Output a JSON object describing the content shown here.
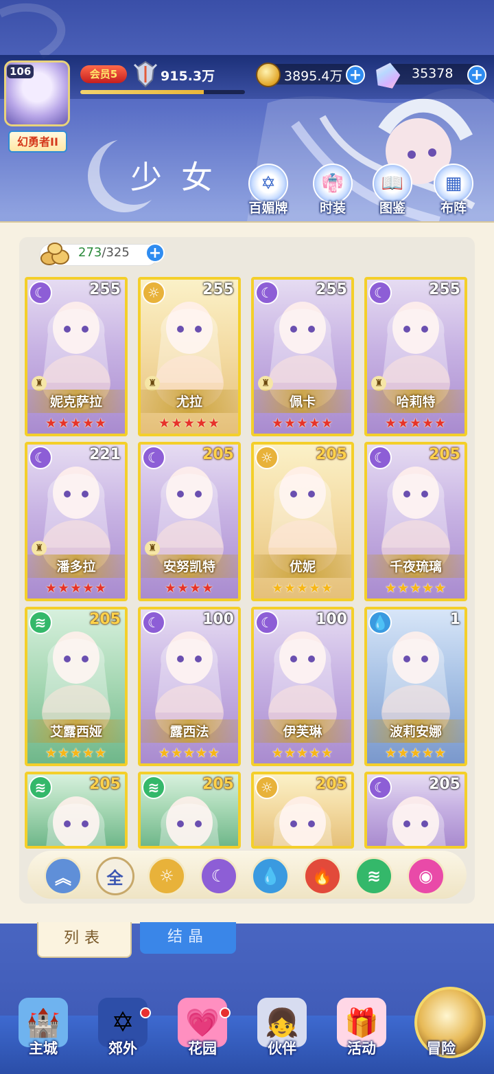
{
  "player": {
    "level": "106",
    "title": "幻勇者II",
    "vip": "会员5",
    "power": "915.3万",
    "exp_progress": 0.75
  },
  "currency": {
    "gold": "3895.4万",
    "gems": "35378"
  },
  "header": {
    "title": "少女",
    "buttons": [
      {
        "label": "百媚牌",
        "icon": "card-icon"
      },
      {
        "label": "时装",
        "icon": "outfit-icon"
      },
      {
        "label": "图鉴",
        "icon": "book-icon"
      },
      {
        "label": "布阵",
        "icon": "grid-icon"
      }
    ]
  },
  "roster": {
    "count": "273",
    "max": "325"
  },
  "cards": [
    {
      "name": "妮克萨拉",
      "level": "255",
      "element": "moon",
      "stars": 5,
      "star_color": "red",
      "rook": true,
      "level_color": "white"
    },
    {
      "name": "尤拉",
      "level": "255",
      "element": "sun",
      "stars": 5,
      "star_color": "red",
      "rook": true,
      "level_color": "white"
    },
    {
      "name": "佩卡",
      "level": "255",
      "element": "moon",
      "stars": 5,
      "star_color": "red",
      "rook": true,
      "level_color": "white"
    },
    {
      "name": "哈莉特",
      "level": "255",
      "element": "moon",
      "stars": 5,
      "star_color": "red",
      "rook": true,
      "level_color": "white"
    },
    {
      "name": "潘多拉",
      "level": "221",
      "element": "moon",
      "stars": 5,
      "star_color": "red",
      "rook": true,
      "level_color": "white"
    },
    {
      "name": "安努凯特",
      "level": "205",
      "element": "moon",
      "stars": 4,
      "star_color": "red",
      "rook": true,
      "level_color": "gold"
    },
    {
      "name": "优妮",
      "level": "205",
      "element": "sun",
      "stars": 5,
      "star_color": "gold",
      "rook": false,
      "level_color": "gold"
    },
    {
      "name": "千夜琉璃",
      "level": "205",
      "element": "moon",
      "stars": 5,
      "star_color": "gold",
      "rook": false,
      "level_color": "gold"
    },
    {
      "name": "艾露西娅",
      "level": "205",
      "element": "wind",
      "stars": 5,
      "star_color": "gold",
      "rook": false,
      "level_color": "gold"
    },
    {
      "name": "露西法",
      "level": "100",
      "element": "moon",
      "stars": 5,
      "star_color": "gold",
      "rook": false,
      "level_color": "white"
    },
    {
      "name": "伊芙琳",
      "level": "100",
      "element": "moon",
      "stars": 5,
      "star_color": "gold",
      "rook": false,
      "level_color": "white"
    },
    {
      "name": "波莉安娜",
      "level": "1",
      "element": "water",
      "stars": 5,
      "star_color": "gold",
      "rook": false,
      "level_color": "white"
    },
    {
      "name": "",
      "level": "205",
      "element": "wind",
      "stars": 0,
      "star_color": "gold",
      "rook": false,
      "level_color": "gold"
    },
    {
      "name": "",
      "level": "205",
      "element": "wind",
      "stars": 0,
      "star_color": "gold",
      "rook": false,
      "level_color": "gold"
    },
    {
      "name": "",
      "level": "205",
      "element": "sun",
      "stars": 0,
      "star_color": "gold",
      "rook": false,
      "level_color": "gold"
    },
    {
      "name": "",
      "level": "205",
      "element": "moon",
      "stars": 0,
      "star_color": "gold",
      "rook": false,
      "level_color": "white"
    }
  ],
  "filters": [
    {
      "key": "collapse",
      "label": "",
      "color": "#5f8fd8"
    },
    {
      "key": "all",
      "label": "全",
      "color": "#f5efe0"
    },
    {
      "key": "sun",
      "label": "",
      "color": "#e8b23a"
    },
    {
      "key": "moon",
      "label": "",
      "color": "#8d5ed6"
    },
    {
      "key": "water",
      "label": "",
      "color": "#3a9ae0"
    },
    {
      "key": "fire",
      "label": "",
      "color": "#e24a3a"
    },
    {
      "key": "wind",
      "label": "",
      "color": "#34b86a"
    },
    {
      "key": "spirit",
      "label": "",
      "color": "#e94aa8"
    }
  ],
  "tabs": {
    "list": "列表",
    "crystal": "结晶"
  },
  "nav": [
    {
      "label": "主城",
      "icon": "castle-icon",
      "badge": false
    },
    {
      "label": "郊外",
      "icon": "wilds-icon",
      "badge": true
    },
    {
      "label": "花园",
      "icon": "garden-icon",
      "badge": true
    },
    {
      "label": "伙伴",
      "icon": "partner-icon",
      "badge": false
    },
    {
      "label": "活动",
      "icon": "gift-icon",
      "badge": false
    },
    {
      "label": "冒险",
      "icon": "adventure-icon",
      "badge": false
    }
  ],
  "colors": {
    "card_border": "#f4cf2a",
    "moon": "#8d5ed6",
    "sun": "#e8b23a",
    "wind": "#34b86a",
    "water": "#3a9ae0"
  }
}
